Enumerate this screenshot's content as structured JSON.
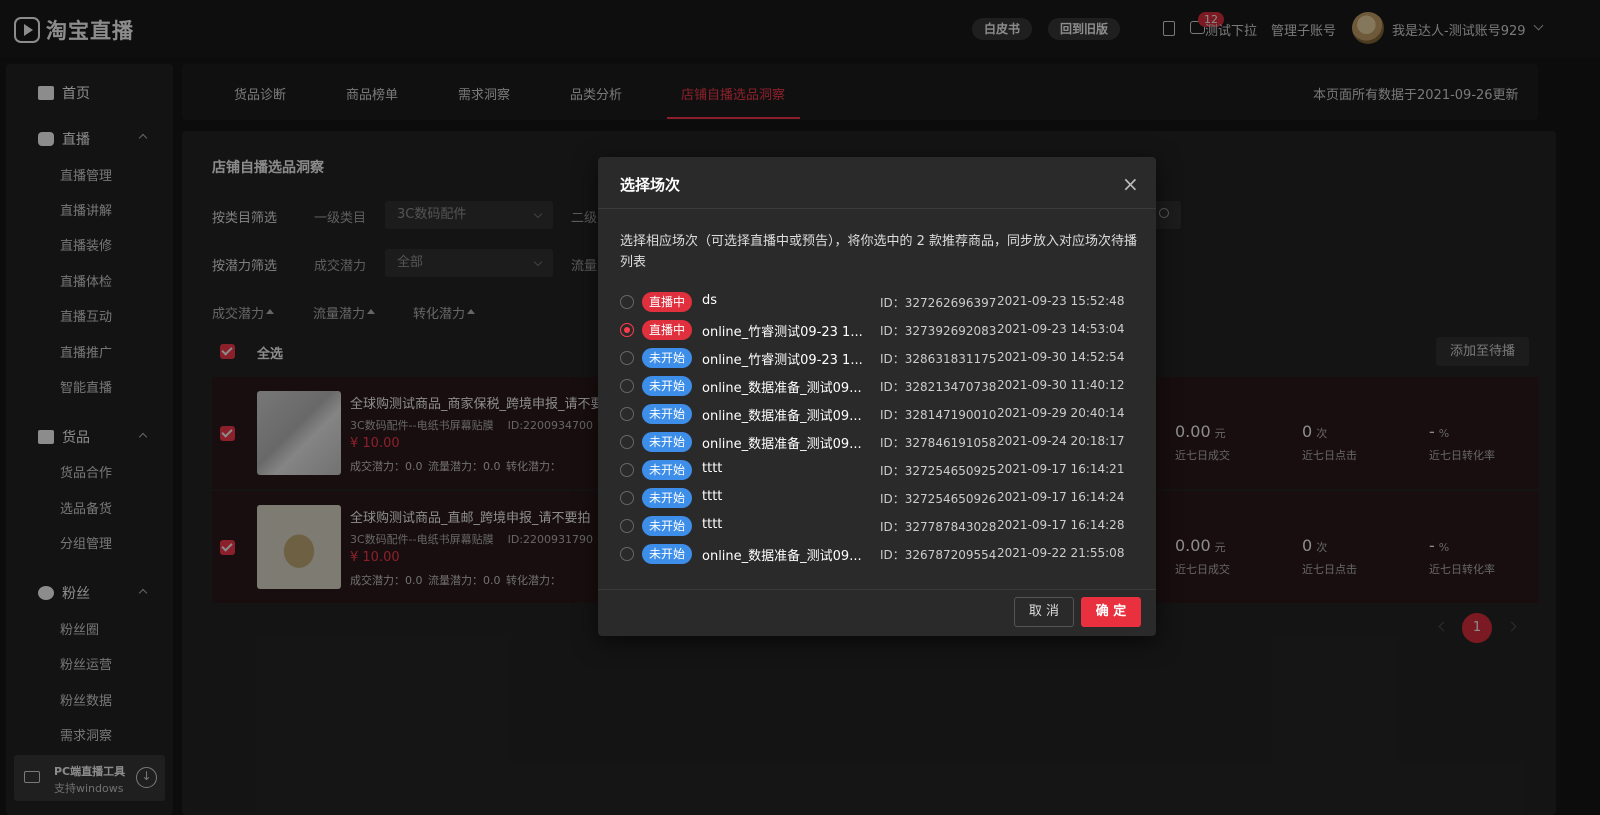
{
  "app": {
    "logo_text": "淘宝直播"
  },
  "topbar": {
    "whitebook": "白皮书",
    "back_old": "回到旧版",
    "msg_count": "12",
    "test_dropdown": "测试下拉",
    "sub_account": "管理子账号",
    "user_name": "我是达人-测试账号929"
  },
  "sidebar": {
    "home": "首页",
    "live": "直播",
    "live_items": [
      "直播管理",
      "直播讲解",
      "直播装修",
      "直播体检",
      "直播互动",
      "直播推广",
      "智能直播"
    ],
    "goods": "货品",
    "goods_items": [
      "货品合作",
      "选品备货",
      "分组管理"
    ],
    "fans": "粉丝",
    "fans_items": [
      "粉丝圈",
      "粉丝运营",
      "粉丝数据",
      "需求洞察"
    ],
    "pc_tool_title": "PC端直播工具",
    "pc_tool_sub": "支持windows"
  },
  "tabs": [
    "货品诊断",
    "商品榜单",
    "需求洞察",
    "品类分析",
    "店铺自播选品洞察"
  ],
  "updated_text": "本页面所有数据于2021-09-26更新",
  "panel": {
    "title": "店铺自播选品洞察",
    "filter_category_label": "按类目筛选",
    "level1_label": "一级类目",
    "level1_value": "3C数码配件",
    "level2_label": "二级",
    "filter_potential_label": "按潜力筛选",
    "deal_potential_label": "成交潜力",
    "deal_potential_value": "全部",
    "traffic_label": "流量",
    "sort_deal": "成交潜力",
    "sort_traffic": "流量潜力",
    "sort_convert": "转化潜力",
    "select_all": "全选",
    "add_button": "添加至待播"
  },
  "products": [
    {
      "title": "全球购测试商品_商家保税_跨境申报_请不要",
      "category": "3C数码配件--电纸书屏幕贴膜",
      "id": "ID:2200934700",
      "price": "¥ 10.00",
      "potential": "成交潜力：0.0   流量潜力：0.0   转化潜力：",
      "deal_value": "0.00",
      "deal_unit": "元",
      "deal_label": "近七日成交",
      "click_value": "0",
      "click_unit": "次",
      "click_label": "近七日点击",
      "rate_value": "-",
      "rate_unit": "%",
      "rate_label": "近七日转化率"
    },
    {
      "title": "全球购测试商品_直邮_跨境申报_请不要拍",
      "category": "3C数码配件--电纸书屏幕贴膜",
      "id": "ID:2200931790",
      "price": "¥ 10.00",
      "potential": "成交潜力：0.0   流量潜力：0.0   转化潜力：",
      "deal_value": "0.00",
      "deal_unit": "元",
      "deal_label": "近七日成交",
      "click_value": "0",
      "click_unit": "次",
      "click_label": "近七日点击",
      "rate_value": "-",
      "rate_unit": "%",
      "rate_label": "近七日转化率"
    }
  ],
  "pagination": {
    "current": "1"
  },
  "modal": {
    "title": "选择场次",
    "close": "×",
    "description": "选择相应场次（可选择直播中或预告），将你选中的 2 款推荐商品，同步放入对应场次待播列表",
    "sessions": [
      {
        "status": "直播中",
        "name": "ds",
        "id": "ID：327262696397",
        "time": "2021-09-23 15:52:48"
      },
      {
        "status": "直播中",
        "name": "online_竹睿测试09-23 1...",
        "id": "ID：327392692083",
        "time": "2021-09-23 14:53:04"
      },
      {
        "status": "未开始",
        "name": "online_竹睿测试09-23 1...",
        "id": "ID：328631831175",
        "time": "2021-09-30 14:52:54"
      },
      {
        "status": "未开始",
        "name": "online_数据准备_测试09...",
        "id": "ID：328213470738",
        "time": "2021-09-30 11:40:12"
      },
      {
        "status": "未开始",
        "name": "online_数据准备_测试09...",
        "id": "ID：328147190010",
        "time": "2021-09-29 20:40:14"
      },
      {
        "status": "未开始",
        "name": "online_数据准备_测试09...",
        "id": "ID：327846191058",
        "time": "2021-09-24 20:18:17"
      },
      {
        "status": "未开始",
        "name": "tttt",
        "id": "ID：327254650925",
        "time": "2021-09-17 16:14:21"
      },
      {
        "status": "未开始",
        "name": "tttt",
        "id": "ID：327254650926",
        "time": "2021-09-17 16:14:24"
      },
      {
        "status": "未开始",
        "name": "tttt",
        "id": "ID：327787843028",
        "time": "2021-09-17 16:14:28"
      },
      {
        "status": "未开始",
        "name": "online_数据准备_测试09...",
        "id": "ID：326787209554",
        "time": "2021-09-22 21:55:08"
      }
    ],
    "selected_index": 1,
    "cancel": "取 消",
    "confirm": "确 定"
  },
  "colors": {
    "accent": "#e0303e",
    "live_tag": "#e0303e",
    "pending_tag": "#3d8ee8"
  }
}
